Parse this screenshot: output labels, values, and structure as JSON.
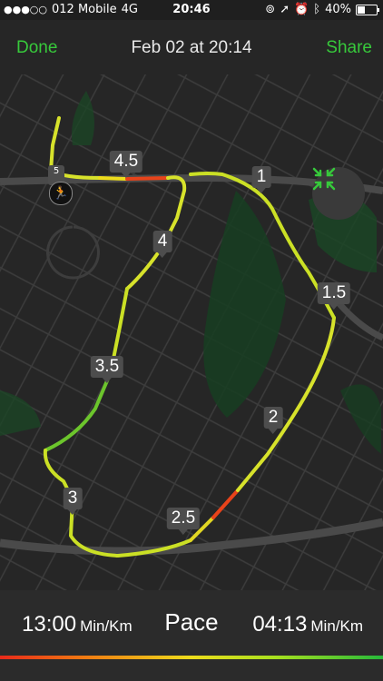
{
  "status_bar": {
    "carrier": "012 Mobile",
    "network": "4G",
    "time": "20:46",
    "battery": "40%",
    "battery_level": 0.4
  },
  "nav": {
    "done_label": "Done",
    "title": "Feb 02 at 20:14",
    "share_label": "Share"
  },
  "map": {
    "start_label": "5",
    "km_markers": [
      "1",
      "1.5",
      "2",
      "2.5",
      "3",
      "3.5",
      "4",
      "4.5"
    ]
  },
  "stats": {
    "slow_pace": "13:00",
    "slow_unit": "Min/Km",
    "metric_label": "Pace",
    "fast_pace": "04:13",
    "fast_unit": "Min/Km"
  },
  "colors": {
    "accent": "#37c93b",
    "route_fast": "#26b83a",
    "route_mid": "#d7e22b",
    "route_slow": "#e82a1a"
  }
}
